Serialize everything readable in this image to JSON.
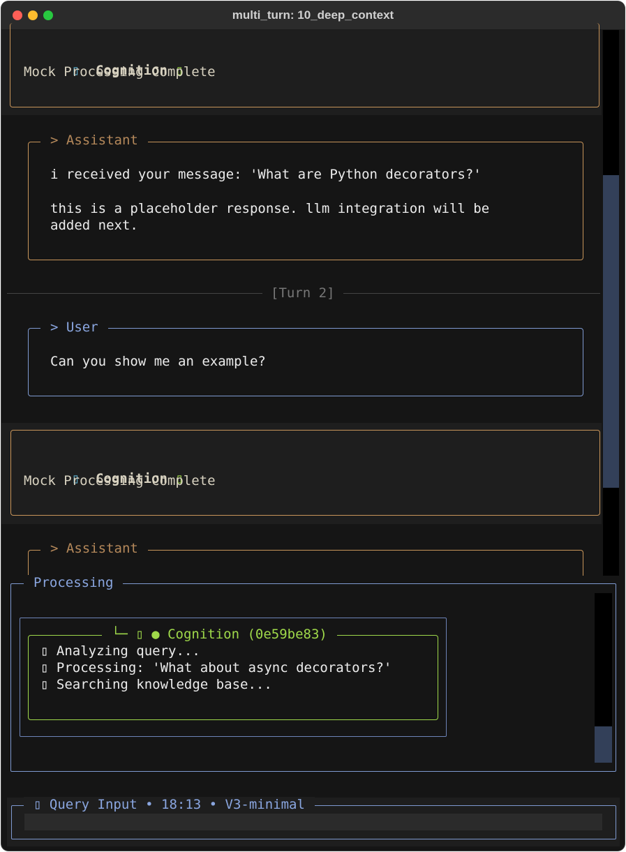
{
  "window": {
    "title": "multi_turn: 10_deep_context"
  },
  "cognition_top": {
    "icon_left": "▯",
    "title": "Cognition",
    "icon_right": "▯",
    "status": "Mock Processing Complete"
  },
  "assistant_1": {
    "label": "> Assistant",
    "line1": "i received your message: 'What are Python decorators?'",
    "line2": "this is a placeholder response. llm integration will be",
    "line3": "added next."
  },
  "turn_divider": {
    "label": "[Turn 2]"
  },
  "user_1": {
    "label": "> User",
    "text": "Can you show me an example?"
  },
  "cognition_2": {
    "icon_left": "▯",
    "title": "Cognition",
    "icon_right": "▯",
    "status": "Mock Processing Complete"
  },
  "assistant_2": {
    "label": "> Assistant"
  },
  "processing": {
    "label": "Processing",
    "cognition_header": "└─ ▯ ● Cognition (0e59be83)",
    "steps": [
      {
        "icon": "▯",
        "text": "Analyzing query..."
      },
      {
        "icon": "▯",
        "text": "Processing: 'What about async decorators?'"
      },
      {
        "icon": "▯",
        "text": "Searching knowledge base..."
      }
    ]
  },
  "query_input": {
    "label": "▯ Query Input • 18:13 • V3-minimal",
    "value": ""
  },
  "colors": {
    "orange": "#c8955a",
    "blue": "#7f9ad1",
    "green": "#9fd94a",
    "background": "#151515"
  }
}
